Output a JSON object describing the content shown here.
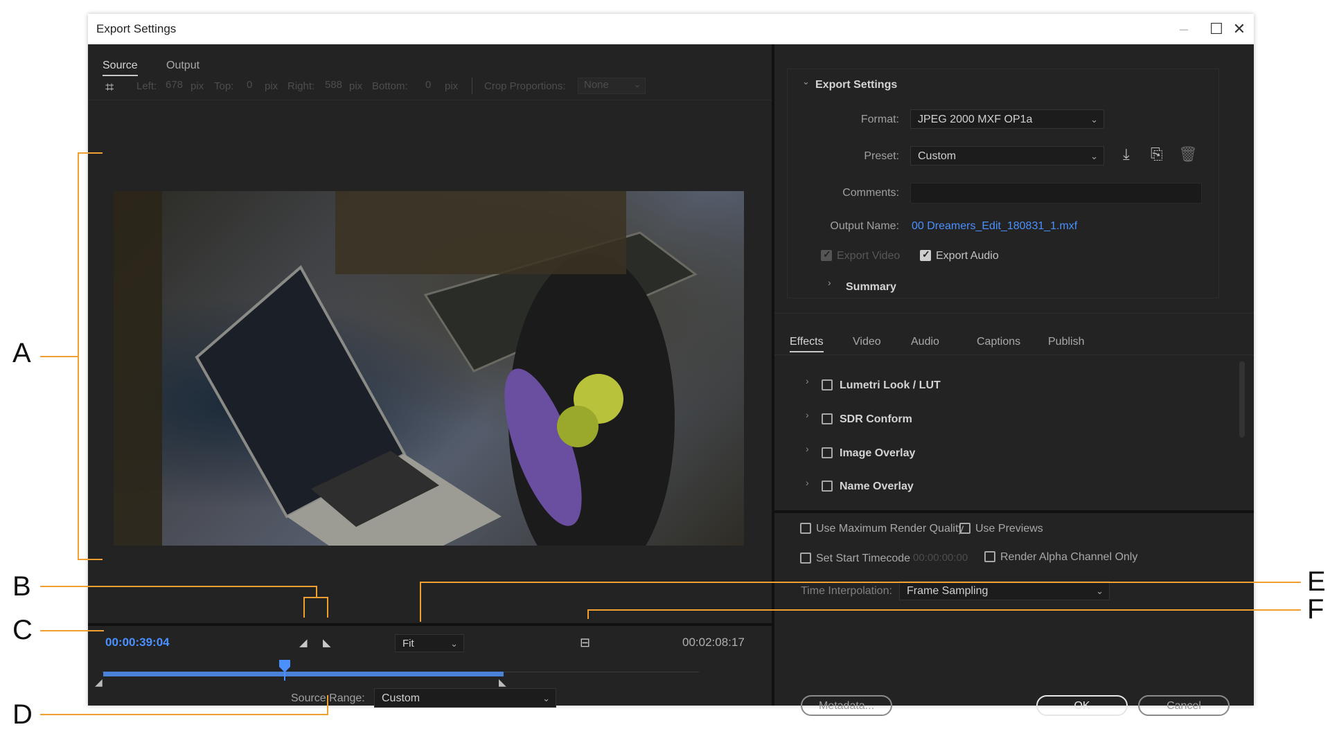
{
  "window": {
    "title": "Export Settings"
  },
  "left": {
    "tabs": [
      "Source",
      "Output"
    ],
    "crop": {
      "left_label": "Left:",
      "left_val": "678",
      "unit": "pix",
      "top_label": "Top:",
      "top_val": "0",
      "right_label": "Right:",
      "right_val": "588",
      "bottom_label": "Bottom:",
      "bottom_val": "0",
      "proportions_label": "Crop Proportions:",
      "proportions_val": "None"
    },
    "timecode_current": "00:00:39:04",
    "timecode_duration": "00:02:08:17",
    "zoom": "Fit",
    "source_range_label": "Source Range:",
    "source_range_value": "Custom",
    "playhead_fraction": 0.304
  },
  "right": {
    "section_title": "Export Settings",
    "format_label": "Format:",
    "format_value": "JPEG 2000 MXF OP1a",
    "preset_label": "Preset:",
    "preset_value": "Custom",
    "comments_label": "Comments:",
    "output_name_label": "Output Name:",
    "output_name_value": "00 Dreamers_Edit_180831_1.mxf",
    "export_video": "Export Video",
    "export_audio": "Export Audio",
    "summary": "Summary",
    "tabs": [
      "Effects",
      "Video",
      "Audio",
      "Captions",
      "Publish"
    ],
    "effects": [
      "Lumetri Look / LUT",
      "SDR Conform",
      "Image Overlay",
      "Name Overlay"
    ],
    "use_max_quality": "Use Maximum Render Quality",
    "use_previews": "Use Previews",
    "set_start_timecode": "Set Start Timecode",
    "start_timecode_val": "00:00:00:00",
    "render_alpha": "Render Alpha Channel Only",
    "time_interp_label": "Time Interpolation:",
    "time_interp_value": "Frame Sampling",
    "metadata_button": "Metadata...",
    "ok_button": "OK",
    "cancel_button": "Cancel"
  },
  "annotations": [
    "A",
    "B",
    "C",
    "D",
    "E",
    "F"
  ],
  "colors": {
    "accent_blue": "#4a90ff",
    "callout_orange": "#f0a030",
    "panel_bg": "#232323"
  }
}
